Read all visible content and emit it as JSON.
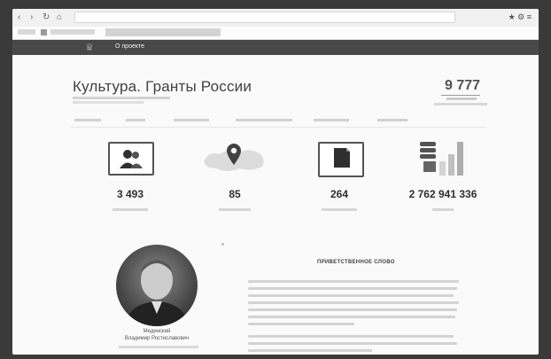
{
  "browser": {
    "back": "‹",
    "forward": "›",
    "reload": "↻",
    "home": "⌂",
    "tools": "★  ⚙  ≡"
  },
  "topbar": {
    "about_label": "О проекте"
  },
  "header": {
    "title": "Культура. Гранты России",
    "total_value": "9 777"
  },
  "stats": [
    {
      "icon": "people-icon",
      "value": "3 493"
    },
    {
      "icon": "map-pin-icon",
      "value": "85"
    },
    {
      "icon": "document-icon",
      "value": "264"
    },
    {
      "icon": "coins-chart-icon",
      "value": "2 762 941 336"
    }
  ],
  "greeting": {
    "title": "ПРИВЕТСТВЕННОЕ СЛОВО",
    "person_name_line1": "Мединский",
    "person_name_line2": "Владимир Ростиславович"
  },
  "colors": {
    "topbar": "#4b4b4b",
    "background": "#f4f4f4"
  }
}
